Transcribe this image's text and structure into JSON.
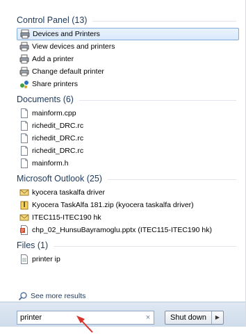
{
  "groups": [
    {
      "title": "Control Panel (13)",
      "items": [
        {
          "label": "Devices and Printers",
          "icon": "devices-printers-icon",
          "selected": true
        },
        {
          "label": "View devices and printers",
          "icon": "printer-icon"
        },
        {
          "label": "Add a printer",
          "icon": "printer-icon"
        },
        {
          "label": "Change default printer",
          "icon": "printer-icon"
        },
        {
          "label": "Share printers",
          "icon": "share-network-icon"
        }
      ]
    },
    {
      "title": "Documents (6)",
      "items": [
        {
          "label": "mainform.cpp",
          "icon": "file-icon"
        },
        {
          "label": "richedit_DRC.rc",
          "icon": "file-icon"
        },
        {
          "label": "richedit_DRC.rc",
          "icon": "file-icon"
        },
        {
          "label": "richedit_DRC.rc",
          "icon": "file-icon"
        },
        {
          "label": "mainform.h",
          "icon": "file-icon"
        }
      ]
    },
    {
      "title": "Microsoft Outlook (25)",
      "items": [
        {
          "label": "kyocera taskalfa driver",
          "icon": "email-envelope-icon"
        },
        {
          "label": "Kyocera TaskAlfa 181.zip (kyocera taskalfa driver)",
          "icon": "zip-file-icon"
        },
        {
          "label": "ITEC115-ITEC190 hk",
          "icon": "email-envelope-icon"
        },
        {
          "label": "chp_02_HunsuBayramoglu.pptx (ITEC115-ITEC190 hk)",
          "icon": "powerpoint-file-icon"
        }
      ]
    },
    {
      "title": "Files (1)",
      "items": [
        {
          "label": "printer ip",
          "icon": "text-file-icon"
        }
      ]
    }
  ],
  "see_more": "See more results",
  "search": {
    "value": "printer"
  },
  "clear_symbol": "×",
  "shutdown": {
    "label": "Shut down"
  },
  "colors": {
    "header": "#1e395b",
    "selection_border": "#84acdd",
    "bar": "#dfe8f3",
    "annotation_arrow": "#d9322b"
  }
}
